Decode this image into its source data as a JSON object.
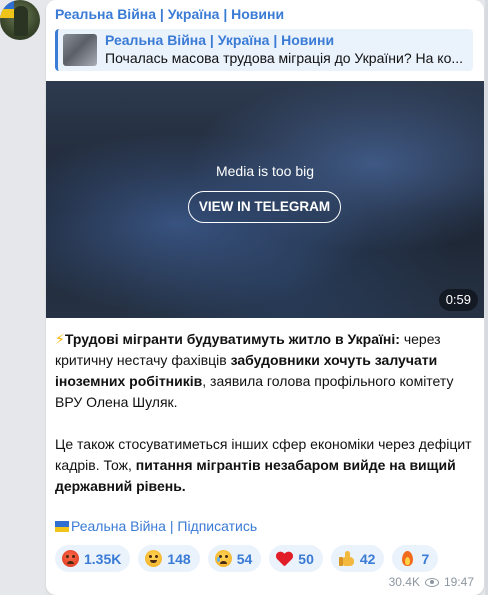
{
  "post": {
    "channel_name": "Реальна Війна | Україна | Новини",
    "forward": {
      "title": "Реальна Війна | Україна | Новини",
      "preview": "Почалась масова трудова міграція до України? На ко..."
    },
    "media": {
      "notice": "Media is too big",
      "button_label": "VIEW IN TELEGRAM",
      "duration": "0:59"
    },
    "body": {
      "bolt": "⚡",
      "p1_bold1": "Трудові мігранти будуватимуть житло в Україні:",
      "p1_text1": " через критичну нестачу фахівців ",
      "p1_bold2": "забудовники хочуть залучати іноземних робітників",
      "p1_text2": ", заявила голова профільного комітету ВРУ Олена Шуляк.",
      "p2_text1": "Це також стосуватиметься інших сфер економіки через дефіцит кадрів. Тож, ",
      "p2_bold1": "питання мігрантів незабаром вийде на вищий державний рівень."
    },
    "signature": {
      "name": "Реальна Війна",
      "separator": " | ",
      "subscribe": "Підписатись"
    },
    "reactions": [
      {
        "emoji": "angry-face",
        "count": "1.35K"
      },
      {
        "emoji": "grinning-face",
        "count": "148"
      },
      {
        "emoji": "crying-face",
        "count": "54"
      },
      {
        "emoji": "red-heart",
        "count": "50"
      },
      {
        "emoji": "thumbs-up",
        "count": "42"
      },
      {
        "emoji": "fire",
        "count": "7"
      }
    ],
    "views": "30.4K",
    "time": "19:47"
  },
  "colors": {
    "accent": "#3a7bd5",
    "background": "#e5e7eb",
    "bubble": "#ffffff",
    "reaction_bg": "#eaf2fc",
    "meta": "#8d96a0"
  }
}
